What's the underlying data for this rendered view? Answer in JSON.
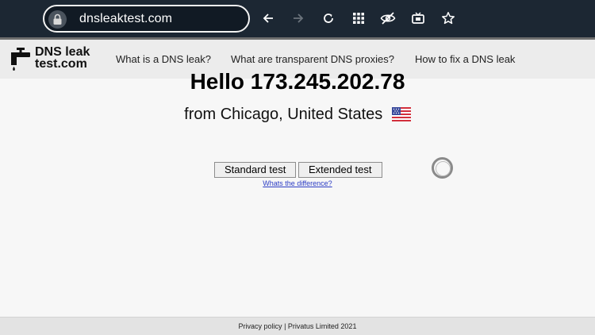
{
  "browser": {
    "url": "dnsleaktest.com",
    "icons": [
      "lock-icon",
      "back-arrow-icon",
      "forward-arrow-icon",
      "reload-icon",
      "apps-grid-icon",
      "eye-off-icon",
      "tv-icon",
      "star-icon"
    ]
  },
  "site": {
    "logo_line1": "DNS leak",
    "logo_line2": "test.com",
    "nav": [
      "What is a DNS leak?",
      "What are transparent DNS proxies?",
      "How to fix a DNS leak"
    ]
  },
  "main": {
    "greeting": "Hello 173.245.202.78",
    "location": "from Chicago, United States",
    "buttons": {
      "standard": "Standard test",
      "extended": "Extended test"
    },
    "difference_link": "Whats the difference?"
  },
  "footer": {
    "text": "Privacy policy | Privatus Limited 2021"
  },
  "colors": {
    "chrome": "#1c2733",
    "nav": "#ececec",
    "link": "#2b3cc4"
  }
}
